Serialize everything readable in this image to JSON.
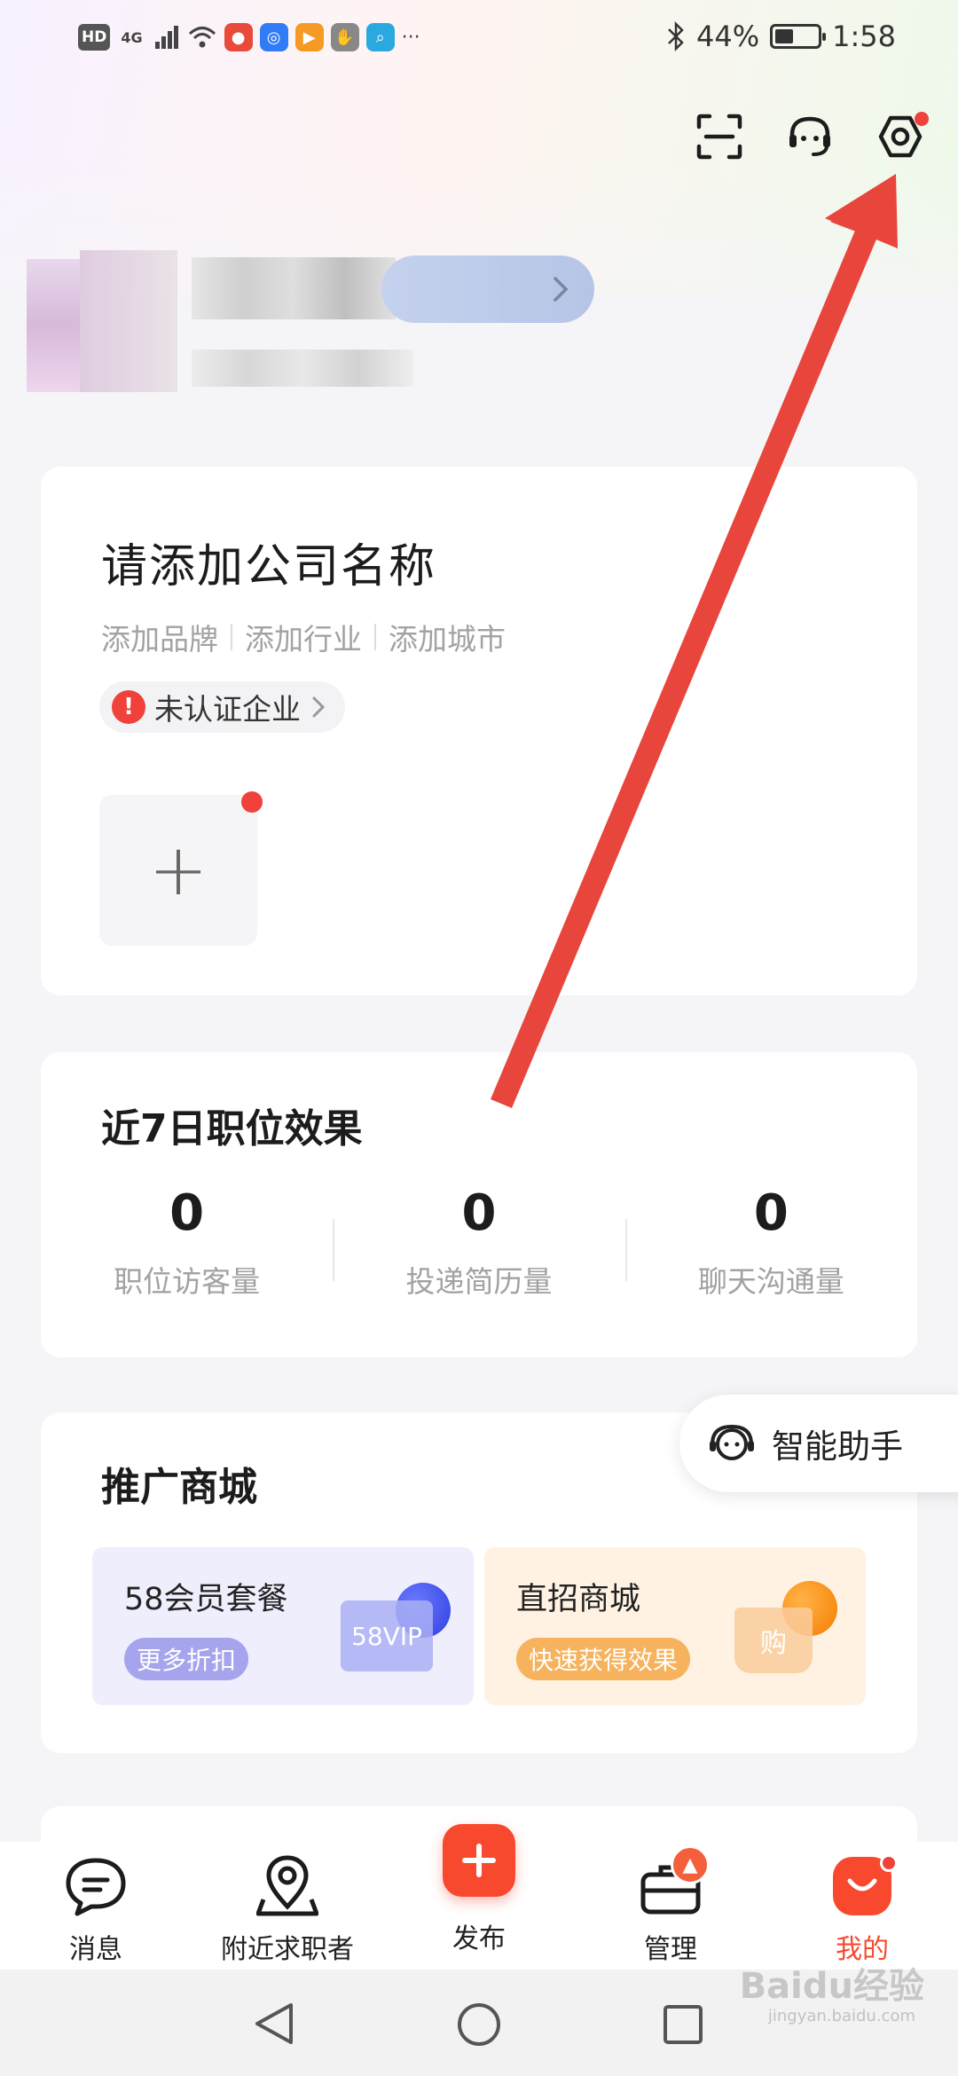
{
  "status_bar": {
    "chips": [
      "HD",
      "4G"
    ],
    "battery_percent": "44%",
    "battery_level": 0.44,
    "time": "1:58"
  },
  "top_actions": [
    "scan-icon",
    "customer-service-icon",
    "settings-icon"
  ],
  "company": {
    "name": "请添加公司名称",
    "links": [
      "添加品牌",
      "添加行业",
      "添加城市"
    ],
    "verify_status": "未认证企业",
    "add_logo_symbol": "+"
  },
  "job_effect": {
    "title": "近7日职位效果",
    "stats": [
      {
        "value": "0",
        "label": "职位访客量"
      },
      {
        "value": "0",
        "label": "投递简历量"
      },
      {
        "value": "0",
        "label": "聊天沟通量"
      }
    ]
  },
  "assistant": {
    "label": "智能助手"
  },
  "promo_mall": {
    "title": "推广商城",
    "items": [
      {
        "title": "58会员套餐",
        "tag": "更多折扣",
        "badge": "58VIP"
      },
      {
        "title": "直招商城",
        "tag": "快速获得效果",
        "badge": "购"
      }
    ]
  },
  "bottom_nav": [
    {
      "label": "消息",
      "icon": "message-icon"
    },
    {
      "label": "附近求职者",
      "icon": "location-icon"
    },
    {
      "label": "发布",
      "icon": "plus-icon"
    },
    {
      "label": "管理",
      "icon": "briefcase-icon"
    },
    {
      "label": "我的",
      "icon": "profile-icon",
      "active": true
    }
  ],
  "watermark": {
    "brand": "Baidu经验",
    "url": "jingyan.baidu.com"
  },
  "colors": {
    "accent": "#f8492f",
    "red_dot": "#f0413a",
    "arrow": "#e8453c"
  }
}
